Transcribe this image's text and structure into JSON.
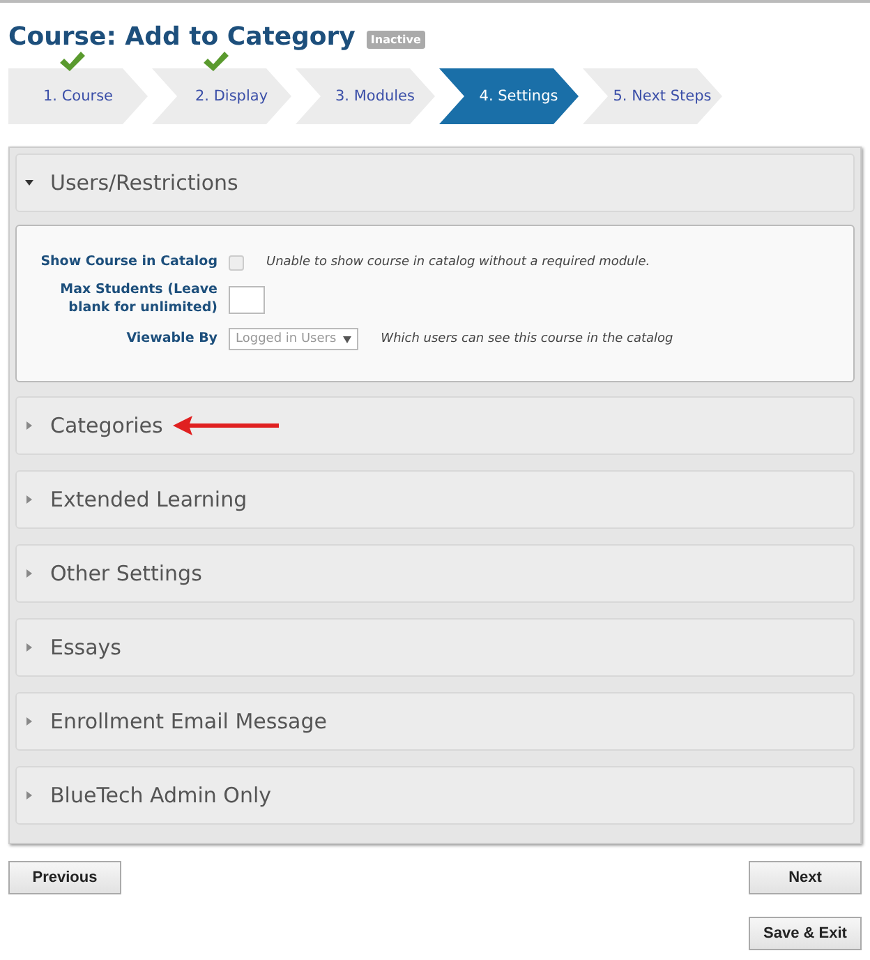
{
  "title": "Course: Add to Category",
  "status_badge": "Inactive",
  "steps": [
    {
      "label": "1. Course",
      "done": true,
      "selected": false
    },
    {
      "label": "2. Display",
      "done": true,
      "selected": false
    },
    {
      "label": "3. Modules",
      "done": false,
      "selected": false
    },
    {
      "label": "4. Settings",
      "done": false,
      "selected": true
    },
    {
      "label": "5. Next Steps",
      "done": false,
      "selected": false
    }
  ],
  "sections": [
    {
      "title": "Users/Restrictions",
      "expanded": true,
      "annotated": false,
      "fields": [
        {
          "kind": "checkbox",
          "label": "Show Course in Catalog",
          "checked": false,
          "disabled": true,
          "note": "Unable to show course in catalog without a required module."
        },
        {
          "kind": "text",
          "label": "Max Students (Leave blank for unlimited)"
        },
        {
          "kind": "select",
          "label": "Viewable By",
          "value": "Logged in Users",
          "disabled": true,
          "note": "Which users can see this course in the catalog"
        }
      ]
    },
    {
      "title": "Categories",
      "expanded": false,
      "annotated": true
    },
    {
      "title": "Extended Learning",
      "expanded": false,
      "annotated": false
    },
    {
      "title": "Other Settings",
      "expanded": false,
      "annotated": false
    },
    {
      "title": "Essays",
      "expanded": false,
      "annotated": false
    },
    {
      "title": "Enrollment Email Message",
      "expanded": false,
      "annotated": false
    },
    {
      "title": "BlueTech Admin Only",
      "expanded": false,
      "annotated": false
    }
  ],
  "buttons": {
    "previous": "Previous",
    "next": "Next",
    "save": "Save & Exit"
  }
}
